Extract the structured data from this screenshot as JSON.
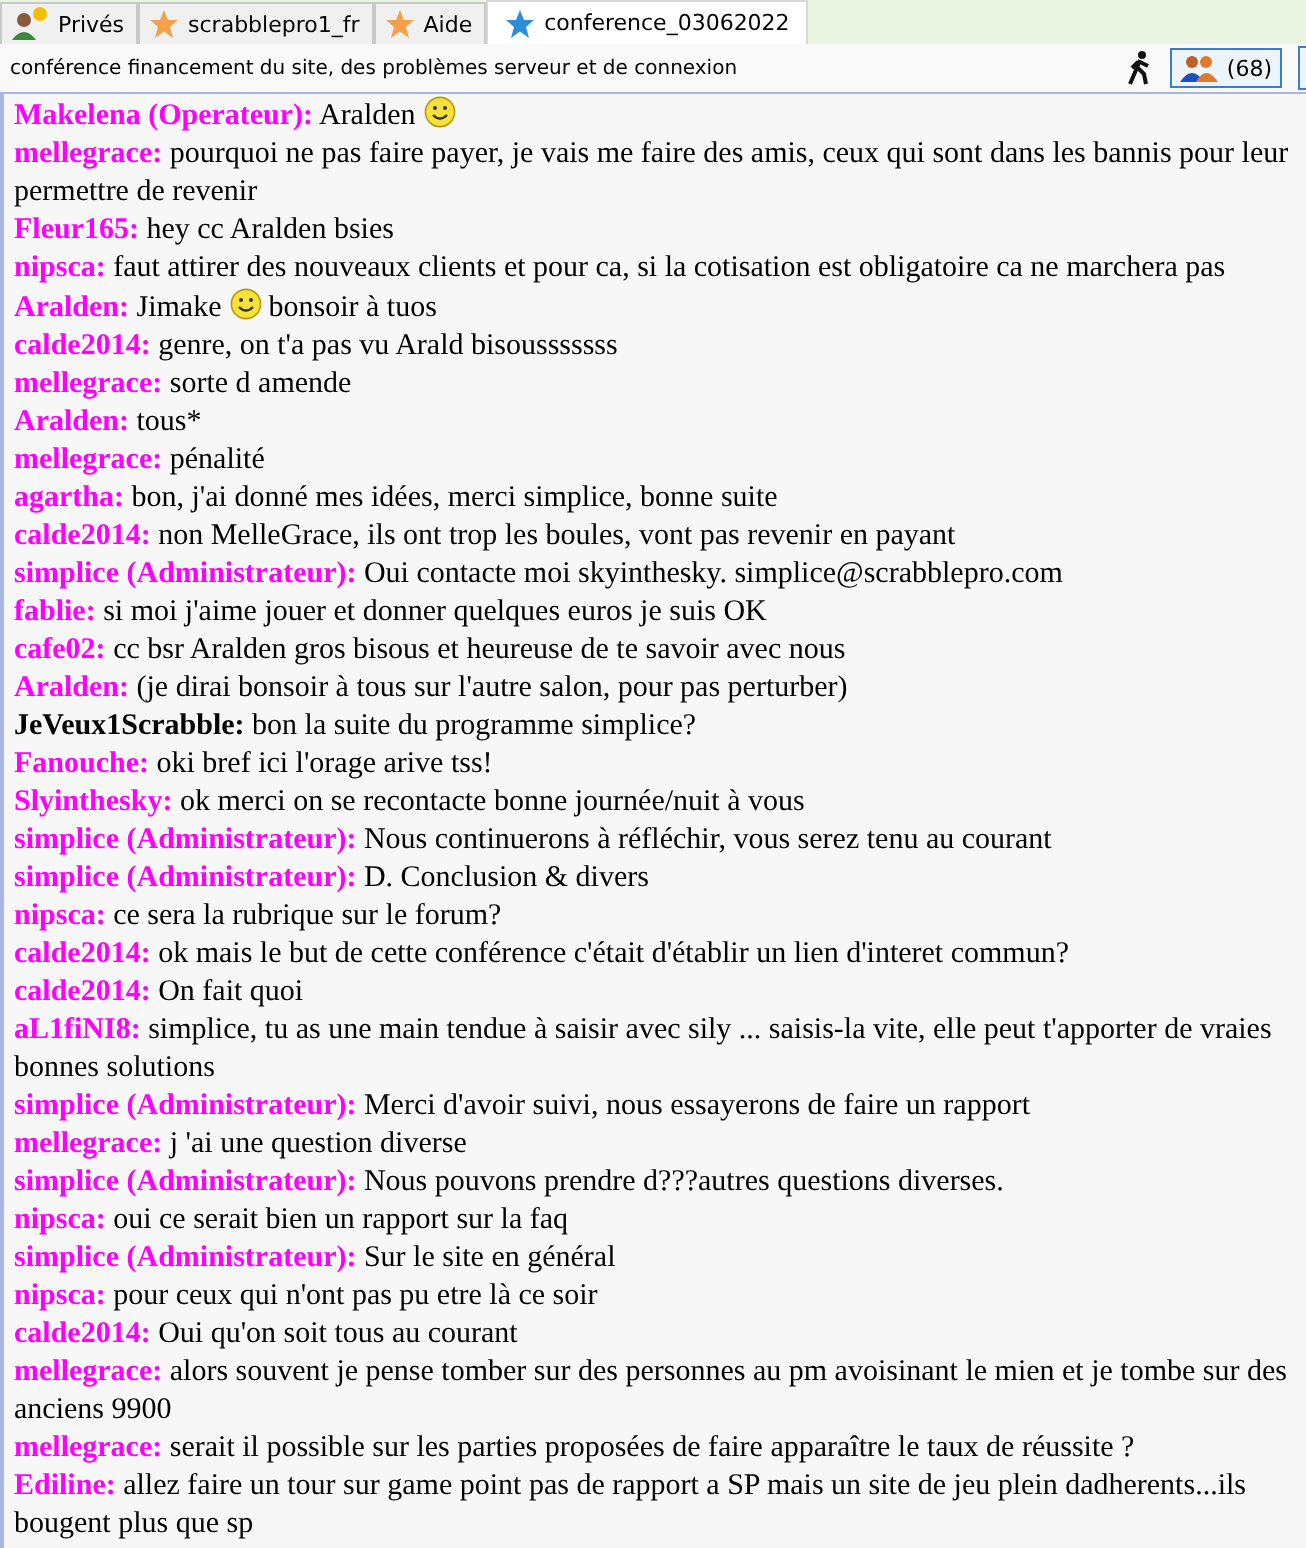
{
  "tabs": [
    {
      "kind": "private",
      "label": "Privés",
      "selected": false
    },
    {
      "kind": "room",
      "label": "scrabblepro1_fr",
      "selected": false
    },
    {
      "kind": "room",
      "label": "Aide",
      "selected": false
    },
    {
      "kind": "room",
      "label": "conference_03062022",
      "selected": true
    }
  ],
  "topic": "conférence financement du site, des problèmes serveur et de connexion",
  "users_count": "(68)",
  "messages": [
    {
      "author": "Makelena (Operateur):",
      "color": "#ff00ff",
      "parts": [
        {
          "kind": "text",
          "text": "Aralden"
        },
        {
          "kind": "smiley"
        }
      ]
    },
    {
      "author": "mellegrace:",
      "color": "#ff00ff",
      "parts": [
        {
          "kind": "text",
          "text": "pourquoi ne pas faire payer, je vais me faire des amis, ceux qui sont dans les bannis pour leur permettre de revenir"
        }
      ]
    },
    {
      "author": "Fleur165:",
      "color": "#ff00ff",
      "parts": [
        {
          "kind": "text",
          "text": "hey cc Aralden bsies"
        }
      ]
    },
    {
      "author": "nipsca:",
      "color": "#ff00ff",
      "parts": [
        {
          "kind": "text",
          "text": "faut attirer des nouveaux clients et pour ca, si la cotisation est obligatoire ca ne marchera pas"
        }
      ]
    },
    {
      "author": "Aralden:",
      "color": "#ff00ff",
      "parts": [
        {
          "kind": "text",
          "text": "Jimake"
        },
        {
          "kind": "smiley"
        },
        {
          "kind": "text",
          "text": "bonsoir à tuos"
        }
      ]
    },
    {
      "author": "calde2014:",
      "color": "#ff00ff",
      "parts": [
        {
          "kind": "text",
          "text": "genre, on t'a pas vu Arald bisousssssss"
        }
      ]
    },
    {
      "author": "mellegrace:",
      "color": "#ff00ff",
      "parts": [
        {
          "kind": "text",
          "text": "sorte d amende"
        }
      ]
    },
    {
      "author": "Aralden:",
      "color": "#ff00ff",
      "parts": [
        {
          "kind": "text",
          "text": "tous*"
        }
      ]
    },
    {
      "author": "mellegrace:",
      "color": "#ff00ff",
      "parts": [
        {
          "kind": "text",
          "text": "pénalité"
        }
      ]
    },
    {
      "author": "agartha:",
      "color": "#ff00ff",
      "parts": [
        {
          "kind": "text",
          "text": "bon, j'ai donné mes idées, merci simplice, bonne suite"
        }
      ]
    },
    {
      "author": "calde2014:",
      "color": "#ff00ff",
      "parts": [
        {
          "kind": "text",
          "text": "non MelleGrace, ils ont trop les boules, vont pas revenir en payant"
        }
      ]
    },
    {
      "author": "simplice (Administrateur):",
      "color": "#ff00ff",
      "parts": [
        {
          "kind": "text",
          "text": "Oui contacte moi skyinthesky. simplice@scrabblepro.com"
        }
      ]
    },
    {
      "author": "fablie:",
      "color": "#ff00ff",
      "parts": [
        {
          "kind": "text",
          "text": "si moi j'aime jouer et donner quelques euros je suis OK"
        }
      ]
    },
    {
      "author": "cafe02:",
      "color": "#ff00ff",
      "parts": [
        {
          "kind": "text",
          "text": "cc bsr Aralden gros bisous et heureuse de te savoir avec nous"
        }
      ]
    },
    {
      "author": "Aralden:",
      "color": "#ff00ff",
      "parts": [
        {
          "kind": "text",
          "text": "(je dirai bonsoir à tous sur l'autre salon, pour pas perturber)"
        }
      ]
    },
    {
      "author": "JeVeux1Scrabble:",
      "color": "#000000",
      "parts": [
        {
          "kind": "text",
          "text": "bon la suite du programme simplice?"
        }
      ]
    },
    {
      "author": "Fanouche:",
      "color": "#ff00ff",
      "parts": [
        {
          "kind": "text",
          "text": "oki bref ici l'orage arive tss!"
        }
      ]
    },
    {
      "author": "Slyinthesky:",
      "color": "#ff00ff",
      "parts": [
        {
          "kind": "text",
          "text": "ok merci on se recontacte bonne journée/nuit à vous"
        }
      ]
    },
    {
      "author": "simplice (Administrateur):",
      "color": "#ff00ff",
      "parts": [
        {
          "kind": "text",
          "text": "Nous continuerons à réfléchir, vous serez tenu au courant"
        }
      ]
    },
    {
      "author": "simplice (Administrateur):",
      "color": "#ff00ff",
      "parts": [
        {
          "kind": "text",
          "text": "D. Conclusion & divers"
        }
      ]
    },
    {
      "author": "nipsca:",
      "color": "#ff00ff",
      "parts": [
        {
          "kind": "text",
          "text": "ce sera la rubrique sur le forum?"
        }
      ]
    },
    {
      "author": "calde2014:",
      "color": "#ff00ff",
      "parts": [
        {
          "kind": "text",
          "text": "ok mais le but de cette conférence c'était d'établir un lien d'interet commun?"
        }
      ]
    },
    {
      "author": "calde2014:",
      "color": "#ff00ff",
      "parts": [
        {
          "kind": "text",
          "text": "On fait quoi"
        }
      ]
    },
    {
      "author": "aL1fiNI8:",
      "color": "#ff00ff",
      "parts": [
        {
          "kind": "text",
          "text": "simplice, tu as une main tendue à saisir avec sily ... saisis-la vite, elle peut t'apporter de vraies bonnes solutions"
        }
      ]
    },
    {
      "author": "simplice (Administrateur):",
      "color": "#ff00ff",
      "parts": [
        {
          "kind": "text",
          "text": "Merci d'avoir suivi, nous essayerons de faire un rapport"
        }
      ]
    },
    {
      "author": "mellegrace:",
      "color": "#ff00ff",
      "parts": [
        {
          "kind": "text",
          "text": "j 'ai une question diverse"
        }
      ]
    },
    {
      "author": "simplice (Administrateur):",
      "color": "#ff00ff",
      "parts": [
        {
          "kind": "text",
          "text": "Nous pouvons prendre d???autres questions diverses."
        }
      ]
    },
    {
      "author": "nipsca:",
      "color": "#ff00ff",
      "parts": [
        {
          "kind": "text",
          "text": "oui ce serait bien un rapport sur la faq"
        }
      ]
    },
    {
      "author": "simplice (Administrateur):",
      "color": "#ff00ff",
      "parts": [
        {
          "kind": "text",
          "text": "Sur le site en général"
        }
      ]
    },
    {
      "author": "nipsca:",
      "color": "#ff00ff",
      "parts": [
        {
          "kind": "text",
          "text": "pour ceux qui n'ont pas pu etre là ce soir"
        }
      ]
    },
    {
      "author": "calde2014:",
      "color": "#ff00ff",
      "parts": [
        {
          "kind": "text",
          "text": "Oui qu'on soit tous au courant"
        }
      ]
    },
    {
      "author": "mellegrace:",
      "color": "#ff00ff",
      "parts": [
        {
          "kind": "text",
          "text": "alors souvent je pense tomber sur des personnes au pm avoisinant le mien et je tombe sur des anciens 9900"
        }
      ]
    },
    {
      "author": "mellegrace:",
      "color": "#ff00ff",
      "parts": [
        {
          "kind": "text",
          "text": "serait il possible sur les parties proposées de faire apparaître le taux de réussite ?"
        }
      ]
    },
    {
      "author": "Ediline:",
      "color": "#ff00ff",
      "parts": [
        {
          "kind": "text",
          "text": "allez faire un tour sur game point pas de rapport a SP mais un site de jeu plein dadherents...ils bougent plus que sp"
        }
      ]
    }
  ]
}
